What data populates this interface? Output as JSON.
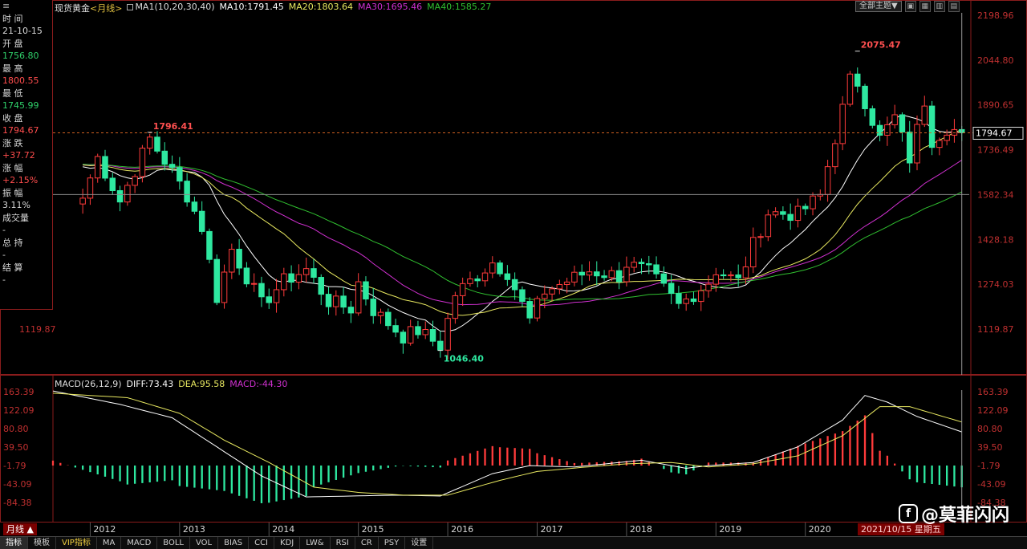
{
  "info": {
    "menu": "≡",
    "time_label": "时 间",
    "time_value": "21-10-15",
    "open_label": "开 盘",
    "open_value": "1756.80",
    "high_label": "最 高",
    "high_value": "1800.55",
    "low_label": "最 低",
    "low_value": "1745.99",
    "close_label": "收 盘",
    "close_value": "1794.67",
    "change_label": "涨 跌",
    "change_value": "+37.72",
    "pct_label": "涨 幅",
    "pct_value": "+2.15%",
    "amp_label": "振 幅",
    "amp_value": "3.11%",
    "vol_label": "成交量",
    "vol_value": "-",
    "hold_label": "总 持",
    "hold_value": "-",
    "settle_label": "结 算",
    "settle_value": "-"
  },
  "legend": {
    "title": "现货黄金",
    "period": "<月线>",
    "ma_main": "MA1(10,20,30,40)",
    "ma10": "MA10:1791.45",
    "ma20": "MA20:1803.64",
    "ma30": "MA30:1695.46",
    "ma40": "MA40:1585.27"
  },
  "toolbar": {
    "theme_button": "全部主题▼"
  },
  "macd_legend": {
    "title": "MACD(26,12,9)",
    "diff": "DIFF:73.43",
    "dea": "DEA:95.58",
    "macd": "MACD:-44.30"
  },
  "colors": {
    "up": "#ff3b3b",
    "down": "#2ee8a0",
    "ma10": "#ffffff",
    "ma20": "#e8e860",
    "ma30": "#d030d0",
    "ma40": "#30c030"
  },
  "chart_data": [
    {
      "type": "candlestick",
      "title": "现货黄金",
      "price_ticks": [
        "2198.96",
        "2044.80",
        "1890.65",
        "1736.49",
        "1582.34",
        "1428.18",
        "1274.03",
        "1119.87"
      ],
      "left_tick": "1119.87",
      "current_price": "1794.67",
      "current_price_value": 1794.67,
      "reference_level": 1582.34,
      "annotations": [
        {
          "text": "2075.47",
          "x": "2020-08",
          "y": 2075.47
        },
        {
          "text": "1796.41",
          "x": "2012-09",
          "y": 1796.41
        },
        {
          "text": "1046.40",
          "x": "2015-12",
          "y": 1046.4
        }
      ],
      "x_labels": [
        "2012",
        "2013",
        "2014",
        "2015",
        "2016",
        "2017",
        "2018",
        "2019",
        "2020"
      ],
      "anchors": [
        {
          "x": "2011-12",
          "y": 1570
        },
        {
          "x": "2012-02",
          "y": 1710
        },
        {
          "x": "2012-05",
          "y": 1560
        },
        {
          "x": "2012-09",
          "y": 1775
        },
        {
          "x": "2012-12",
          "y": 1660
        },
        {
          "x": "2013-02",
          "y": 1580
        },
        {
          "x": "2013-04",
          "y": 1470
        },
        {
          "x": "2013-06",
          "y": 1230
        },
        {
          "x": "2013-08",
          "y": 1395
        },
        {
          "x": "2013-12",
          "y": 1205
        },
        {
          "x": "2014-03",
          "y": 1285
        },
        {
          "x": "2014-06",
          "y": 1325
        },
        {
          "x": "2014-09",
          "y": 1215
        },
        {
          "x": "2014-12",
          "y": 1190
        },
        {
          "x": "2015-01",
          "y": 1280
        },
        {
          "x": "2015-03",
          "y": 1185
        },
        {
          "x": "2015-07",
          "y": 1095
        },
        {
          "x": "2015-09",
          "y": 1115
        },
        {
          "x": "2015-12",
          "y": 1062
        },
        {
          "x": "2016-02",
          "y": 1240
        },
        {
          "x": "2016-07",
          "y": 1350
        },
        {
          "x": "2016-09",
          "y": 1315
        },
        {
          "x": "2016-12",
          "y": 1150
        },
        {
          "x": "2017-02",
          "y": 1250
        },
        {
          "x": "2017-08",
          "y": 1320
        },
        {
          "x": "2017-12",
          "y": 1303
        },
        {
          "x": "2018-01",
          "y": 1345
        },
        {
          "x": "2018-04",
          "y": 1315
        },
        {
          "x": "2018-08",
          "y": 1200
        },
        {
          "x": "2018-12",
          "y": 1282
        },
        {
          "x": "2019-01",
          "y": 1322
        },
        {
          "x": "2019-04",
          "y": 1283
        },
        {
          "x": "2019-06",
          "y": 1410
        },
        {
          "x": "2019-08",
          "y": 1520
        },
        {
          "x": "2019-12",
          "y": 1515
        },
        {
          "x": "2020-03",
          "y": 1578
        },
        {
          "x": "2020-04",
          "y": 1680
        },
        {
          "x": "2020-07",
          "y": 1975
        },
        {
          "x": "2020-08",
          "y": 1968
        },
        {
          "x": "2020-11",
          "y": 1775
        },
        {
          "x": "2021-01",
          "y": 1848
        },
        {
          "x": "2021-03",
          "y": 1706
        },
        {
          "x": "2021-05",
          "y": 1905
        },
        {
          "x": "2021-06",
          "y": 1770
        },
        {
          "x": "2021-08",
          "y": 1813
        },
        {
          "x": "2021-10",
          "y": 1794.67
        }
      ],
      "moving_averages": [
        "MA10",
        "MA20",
        "MA30",
        "MA40"
      ],
      "x_range": [
        "2011-08",
        "2021-11"
      ]
    },
    {
      "type": "bar+line",
      "title": "MACD(26,12,9)",
      "y_ticks": [
        "163.39",
        "122.09",
        "80.80",
        "39.50",
        "-1.79",
        "-43.09",
        "-84.38"
      ],
      "x_labels": [
        "2012",
        "2013",
        "2014",
        "2015",
        "2016",
        "2017",
        "2018",
        "2019",
        "2020",
        "2021"
      ],
      "diff": [
        {
          "x": "2011-08",
          "y": 165
        },
        {
          "x": "2012-05",
          "y": 135
        },
        {
          "x": "2012-12",
          "y": 105
        },
        {
          "x": "2013-06",
          "y": 40
        },
        {
          "x": "2013-12",
          "y": -25
        },
        {
          "x": "2014-06",
          "y": -72
        },
        {
          "x": "2014-12",
          "y": -70
        },
        {
          "x": "2015-06",
          "y": -68
        },
        {
          "x": "2015-12",
          "y": -70
        },
        {
          "x": "2016-07",
          "y": -20
        },
        {
          "x": "2016-12",
          "y": -2
        },
        {
          "x": "2017-06",
          "y": -5
        },
        {
          "x": "2017-12",
          "y": 5
        },
        {
          "x": "2018-03",
          "y": 10
        },
        {
          "x": "2018-09",
          "y": -8
        },
        {
          "x": "2018-12",
          "y": -2
        },
        {
          "x": "2019-06",
          "y": 5
        },
        {
          "x": "2019-12",
          "y": 40
        },
        {
          "x": "2020-06",
          "y": 100
        },
        {
          "x": "2020-09",
          "y": 155
        },
        {
          "x": "2020-12",
          "y": 140
        },
        {
          "x": "2021-04",
          "y": 108
        },
        {
          "x": "2021-10",
          "y": 73.43
        }
      ],
      "dea": [
        {
          "x": "2011-08",
          "y": 160
        },
        {
          "x": "2012-06",
          "y": 150
        },
        {
          "x": "2013-01",
          "y": 115
        },
        {
          "x": "2013-07",
          "y": 55
        },
        {
          "x": "2014-01",
          "y": 5
        },
        {
          "x": "2014-07",
          "y": -50
        },
        {
          "x": "2015-01",
          "y": -62
        },
        {
          "x": "2015-07",
          "y": -68
        },
        {
          "x": "2016-01",
          "y": -68
        },
        {
          "x": "2016-08",
          "y": -35
        },
        {
          "x": "2017-01",
          "y": -15
        },
        {
          "x": "2017-07",
          "y": -6
        },
        {
          "x": "2018-01",
          "y": 2
        },
        {
          "x": "2018-07",
          "y": 5
        },
        {
          "x": "2018-12",
          "y": -5
        },
        {
          "x": "2019-06",
          "y": 2
        },
        {
          "x": "2019-12",
          "y": 20
        },
        {
          "x": "2020-06",
          "y": 65
        },
        {
          "x": "2020-11",
          "y": 130
        },
        {
          "x": "2021-03",
          "y": 130
        },
        {
          "x": "2021-10",
          "y": 95.58
        }
      ],
      "histogram_note": "MACD bars = DIFF - DEA",
      "x_range": [
        "2011-08",
        "2021-11"
      ],
      "y_range": [
        -110,
        190
      ]
    }
  ],
  "bottom_tabs": [
    "指标",
    "模板",
    "VIP指标",
    "MA",
    "MACD",
    "BOLL",
    "VOL",
    "BIAS",
    "CCI",
    "KDJ",
    "LW&",
    "RSI",
    "CR",
    "PSY",
    "设置"
  ],
  "period_badge": "月线 ▲",
  "date_badge": "2021/10/15 星期五",
  "watermark": "@莫菲闪闪"
}
